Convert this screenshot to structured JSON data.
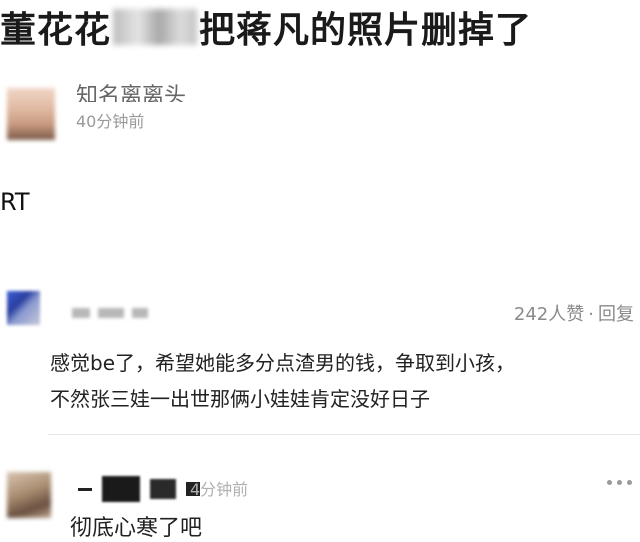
{
  "title": {
    "prefix": "董花花",
    "suffix": "把蒋凡的照片删掉了"
  },
  "post": {
    "author": "知名离离头",
    "time": "40分钟前",
    "body": "RT"
  },
  "comments": [
    {
      "likes": "242人赞",
      "separator": "·",
      "reply_label": "回复",
      "text_line1": "感觉be了，希望她能多分点渣男的钱，争取到小孩，",
      "text_line2": "不然张三娃一出世那俩小娃娃肯定没好日子"
    },
    {
      "time": "4分钟前",
      "more_icon": "more-dots-icon",
      "text": "彻底心寒了吧"
    }
  ]
}
